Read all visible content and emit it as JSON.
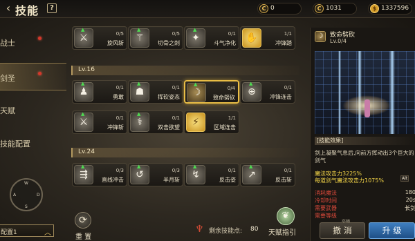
{
  "header": {
    "title": "技能",
    "back_icon": "back-arrow-icon",
    "help_label": "?",
    "currencies": [
      {
        "icon": "C",
        "value": "0"
      },
      {
        "icon": "C",
        "value": "1031"
      },
      {
        "icon": "$",
        "value": "1337596"
      }
    ]
  },
  "sidebar": {
    "items": [
      {
        "label": "战士",
        "active": false,
        "dot": true
      },
      {
        "label": "剑圣",
        "active": true,
        "dot": true
      },
      {
        "label": "天赋",
        "active": false,
        "dot": false
      },
      {
        "label": "技能配置",
        "active": false,
        "dot": false
      }
    ],
    "dpad": {
      "w": "W",
      "a": "A",
      "s": "S",
      "d": "D"
    },
    "config_label": "配置1"
  },
  "tree": {
    "levels": [
      "Lv.16",
      "Lv.24"
    ],
    "row1": [
      {
        "icon": "⚔",
        "level": "0/5",
        "name": "旋风斩",
        "gold": false
      },
      {
        "icon": "⚚",
        "level": "0/5",
        "name": "切骨之刺",
        "gold": false
      },
      {
        "icon": "✦",
        "level": "0/1",
        "name": "斗气净化",
        "gold": false
      },
      {
        "icon": "✋",
        "level": "1/1",
        "name": "冲锋踏",
        "gold": true
      }
    ],
    "row2": [
      {
        "icon": "♟",
        "level": "0/1",
        "name": "勇敢",
        "gold": false
      },
      {
        "icon": "☗",
        "level": "0/1",
        "name": "挥砍姿态",
        "gold": false
      },
      {
        "icon": "☽",
        "level": "0/4",
        "name": "致命劈砍",
        "gold": false,
        "selected": true
      },
      {
        "icon": "⊕",
        "level": "0/1",
        "name": "冲锋连击",
        "gold": false
      }
    ],
    "row3": [
      {
        "icon": "⚔",
        "level": "0/1",
        "name": "冲锋斩",
        "gold": false
      },
      {
        "icon": "⚕",
        "level": "0/1",
        "name": "双击欲望",
        "gold": false
      },
      {
        "icon": "⚡",
        "level": "1/1",
        "name": "区域连击",
        "gold": true
      }
    ],
    "row4": [
      {
        "icon": "⇶",
        "level": "0/3",
        "name": "直线冲击",
        "gold": false
      },
      {
        "icon": "↺",
        "level": "0/3",
        "name": "半月斩",
        "gold": false
      },
      {
        "icon": "↯",
        "level": "0/1",
        "name": "反击姿",
        "gold": false
      },
      {
        "icon": "↗",
        "level": "0/1",
        "name": "反击斩",
        "gold": false
      }
    ],
    "arrow_icon": "▲"
  },
  "bottom": {
    "reset_label": "重 置",
    "points_label": "剩余技能点:",
    "points_value": "80",
    "guide_label": "天赋指引",
    "cancel_label": "撤 消",
    "upgrade_label": "升 级",
    "lock_tag": "交锁"
  },
  "detail": {
    "name": "致命劈砍",
    "level": "Lv.0/4",
    "effect_title": "[技能效果]",
    "description": "剑上凝聚气息后,向前方挥动出3个巨大的剑气",
    "stat1": "魔法攻击力3225%",
    "stat2": "每道剑气魔法攻击力1075%",
    "alt_tag": "Alt",
    "requirements": [
      {
        "key": "消耗魔法",
        "value": "180"
      },
      {
        "key": "冷却时间",
        "value": "20s"
      },
      {
        "key": "需要武器",
        "value": "长剑"
      },
      {
        "key": "需要等级",
        "value": ""
      }
    ]
  }
}
